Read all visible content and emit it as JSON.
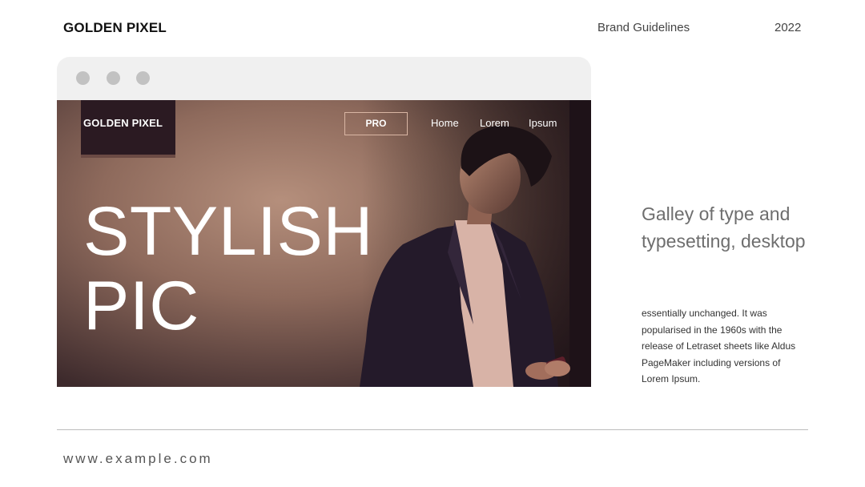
{
  "header": {
    "brand": "GOLDEN PIXEL",
    "section": "Brand Guidelines",
    "year": "2022"
  },
  "mockup": {
    "site_logo": "GOLDEN PIXEL",
    "pro_button": "PRO",
    "nav": [
      "Home",
      "Lorem",
      "Ipsum"
    ],
    "hero_title_line1": "STYLISH",
    "hero_title_line2": "PIC"
  },
  "side": {
    "heading": "Galley of type and typesetting, desktop",
    "body": "essentially unchanged. It was popularised in the 1960s with the release of Letraset sheets like Aldus PageMaker including versions of Lorem Ipsum."
  },
  "footer": {
    "url": "www.example.com"
  },
  "colors": {
    "window_bar": "#f0f0f0",
    "window_dots": "#c2c2c2",
    "divider": "#bdbdbd"
  }
}
